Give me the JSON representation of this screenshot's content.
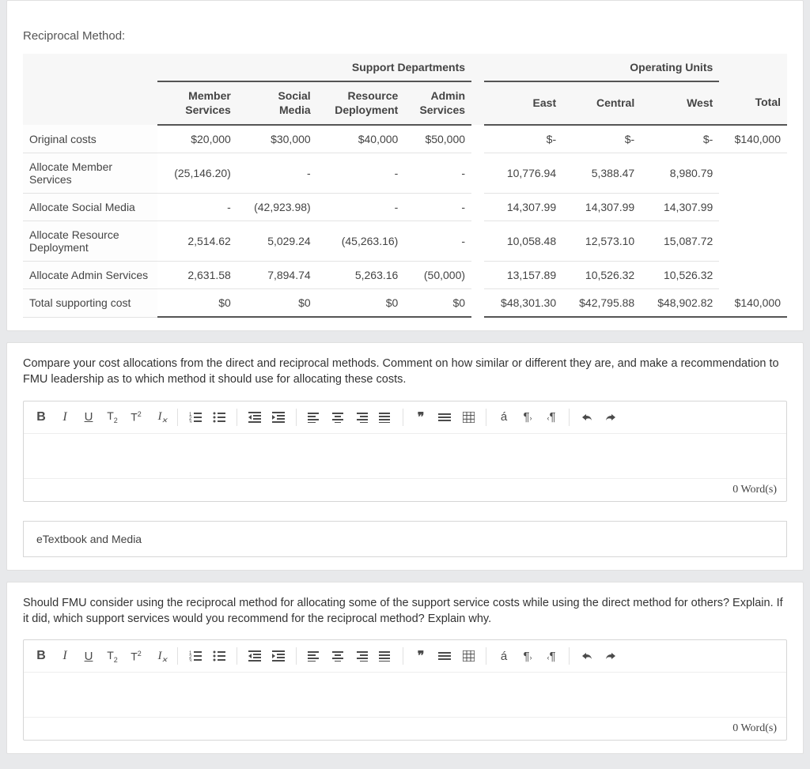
{
  "section_title": "Reciprocal Method:",
  "chart_data": {
    "type": "table",
    "title": "Reciprocal Method cost allocation",
    "column_groups": {
      "support": "Support Departments",
      "operating": "Operating Units"
    },
    "columns": [
      "Member Services",
      "Social Media",
      "Resource Deployment",
      "Admin Services",
      "East",
      "Central",
      "West",
      "Total"
    ],
    "rows": [
      {
        "label": "Original costs",
        "cells": [
          "$20,000",
          "$30,000",
          "$40,000",
          "$50,000",
          "$-",
          "$-",
          "$-",
          "$140,000"
        ]
      },
      {
        "label": "Allocate Member Services",
        "cells": [
          "(25,146.20)",
          "-",
          "-",
          "-",
          "10,776.94",
          "5,388.47",
          "8,980.79",
          ""
        ]
      },
      {
        "label": "Allocate Social Media",
        "cells": [
          "-",
          "(42,923.98)",
          "-",
          "-",
          "14,307.99",
          "14,307.99",
          "14,307.99",
          ""
        ]
      },
      {
        "label": "Allocate Resource Deployment",
        "cells": [
          "2,514.62",
          "5,029.24",
          "(45,263.16)",
          "-",
          "10,058.48",
          "12,573.10",
          "15,087.72",
          ""
        ]
      },
      {
        "label": "Allocate Admin Services",
        "cells": [
          "2,631.58",
          "7,894.74",
          "5,263.16",
          "(50,000)",
          "13,157.89",
          "10,526.32",
          "10,526.32",
          ""
        ]
      },
      {
        "label": "Total supporting cost",
        "cells": [
          "$0",
          "$0",
          "$0",
          "$0",
          "$48,301.30",
          "$42,795.88",
          "$48,902.82",
          "$140,000"
        ]
      }
    ]
  },
  "prompt1": "Compare your cost allocations from the direct and reciprocal methods. Comment on how similar or different they are, and make a recommendation to FMU leadership as to which method it should use for allocating these costs.",
  "prompt2": "Should FMU consider using the reciprocal method for allocating some of the support service costs while using the direct method for others? Explain. If it did, which support services would you recommend for the reciprocal method? Explain why.",
  "etext_label": "eTextbook and Media",
  "editor": {
    "word_count_label": "0 Word(s)",
    "buttons": {
      "bold": "B",
      "italic": "I",
      "underline": "U",
      "sub": "T₂",
      "sup": "T²",
      "clear": "I",
      "ol": "ol",
      "ul": "ul",
      "outdent": "⇤",
      "indent": "⇥",
      "al": "left",
      "ac": "center",
      "ar": "right",
      "aj": "justify",
      "quote": "❞",
      "hr": "≡",
      "table": "▦",
      "char": "á",
      "ltr": "¶",
      "rtl": "¶",
      "undo": "↶",
      "redo": "↷"
    }
  }
}
